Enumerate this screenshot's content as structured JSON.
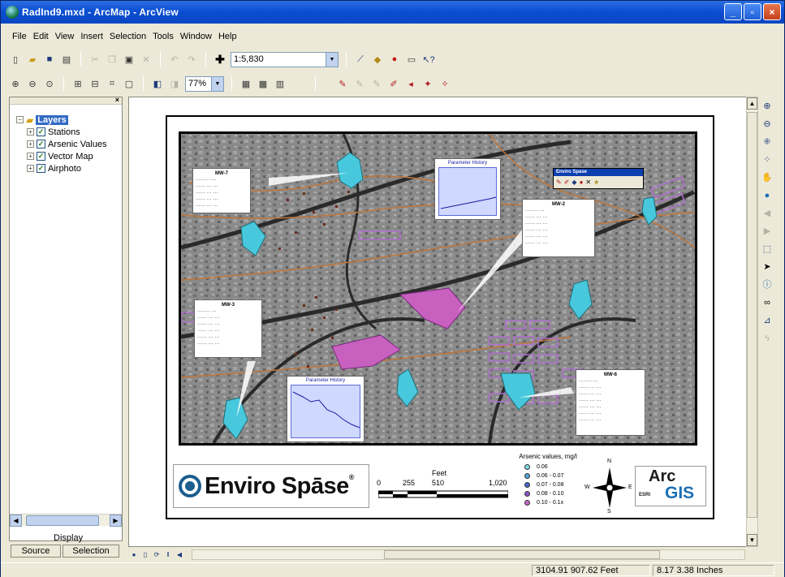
{
  "window": {
    "title": "RadInd9.mxd - ArcMap - ArcView",
    "controls": [
      "_",
      "▫",
      "×"
    ]
  },
  "menu": [
    "File",
    "Edit",
    "View",
    "Insert",
    "Selection",
    "Tools",
    "Window",
    "Help"
  ],
  "toolbar": {
    "scale": "1:5,830",
    "zoom_percent": "77%"
  },
  "toc": {
    "root": "Layers",
    "layers": [
      "Stations",
      "Arsenic Values",
      "Vector Map",
      "Airphoto"
    ],
    "display_label": "Display",
    "tabs": [
      "Source",
      "Selection"
    ]
  },
  "layout": {
    "logo_text": "Enviro Spāse",
    "logo_reg": "®",
    "scale_unit": "Feet",
    "scale_ticks": [
      "0",
      "255",
      "510",
      "1,020"
    ],
    "legend_title": "Arsenic values, mg/l",
    "legend_items": [
      {
        "label": "0.06",
        "color": "#7fd8e8"
      },
      {
        "label": "0.06 - 0.07",
        "color": "#55a4d8"
      },
      {
        "label": "0.07 - 0.08",
        "color": "#4466c8"
      },
      {
        "label": "0.08 - 0.10",
        "color": "#8a55c8"
      },
      {
        "label": "0.10 - 0.1x",
        "color": "#c866c8"
      }
    ],
    "compass": {
      "n": "N",
      "s": "S",
      "e": "E",
      "w": "W"
    },
    "arcgis": {
      "arc": "Arc",
      "gis": "GIS",
      "esri": "ESRI"
    },
    "enviro_toolbar_title": "Enviro Spase",
    "graph_titles": [
      "Parameter History",
      "Parameter History"
    ],
    "callout_titles": [
      "MW-7",
      "MW-2",
      "MW-3",
      "MW-6"
    ]
  },
  "status": {
    "coords": "3104.91  907.62 Feet",
    "page": "8.17  3.38 Inches"
  },
  "colors": {
    "title_blue": "#0c4fd3",
    "selection_blue": "#316ac5",
    "arsenic_cyan": "#4fd0e0",
    "arsenic_magenta": "#c860c0"
  }
}
